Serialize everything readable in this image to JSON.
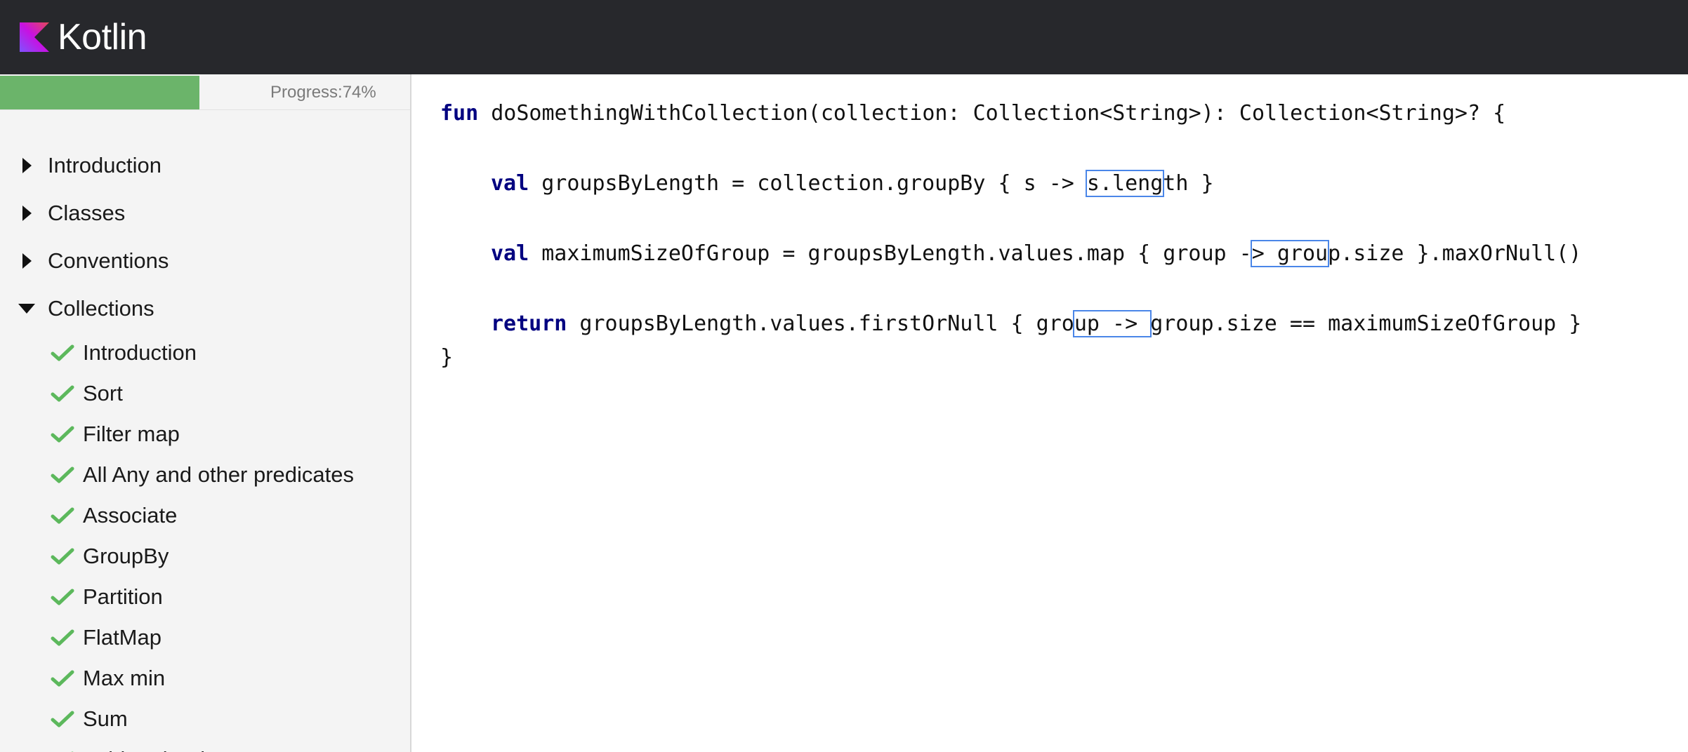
{
  "header": {
    "logo_text": "Kotlin",
    "brand_colors": [
      "#7f52ff",
      "#c811e2",
      "#e44857"
    ]
  },
  "progress": {
    "label": "Progress:74%",
    "percent": 74,
    "fill_color": "#6bb46a"
  },
  "nav": {
    "sections": [
      {
        "label": "Introduction",
        "state": "collapsed"
      },
      {
        "label": "Classes",
        "state": "collapsed"
      },
      {
        "label": "Conventions",
        "state": "collapsed"
      },
      {
        "label": "Collections",
        "state": "expanded"
      }
    ],
    "collections_items": [
      {
        "label": "Introduction",
        "done": true
      },
      {
        "label": "Sort",
        "done": true
      },
      {
        "label": "Filter map",
        "done": true
      },
      {
        "label": "All Any and other predicates",
        "done": true
      },
      {
        "label": "Associate",
        "done": true
      },
      {
        "label": "GroupBy",
        "done": true
      },
      {
        "label": "Partition",
        "done": true
      },
      {
        "label": "FlatMap",
        "done": true
      },
      {
        "label": "Max min",
        "done": true
      },
      {
        "label": "Sum",
        "done": true
      },
      {
        "label": "Fold and reduce",
        "done": true
      }
    ]
  },
  "code": {
    "line1": {
      "kw": "fun",
      "rest": " doSomethingWithCollection(collection: Collection<String>): Collection<String>? {"
    },
    "line2": {
      "kw": "val",
      "pre": " groupsByLength = collection.groupBy { s -> ",
      "hl": "s.leng",
      "post": "th }"
    },
    "line3": {
      "kw": "val",
      "pre": " maximumSizeOfGroup = groupsByLength.values.map { group -",
      "hl": "> grou",
      "post": "p.size }.maxOrNull()"
    },
    "line4": {
      "kw": "return",
      "pre": " groupsByLength.values.firstOrNull { gro",
      "hl": "up -> ",
      "post": "group.size == maximumSizeOfGroup }"
    },
    "line5": "}"
  }
}
